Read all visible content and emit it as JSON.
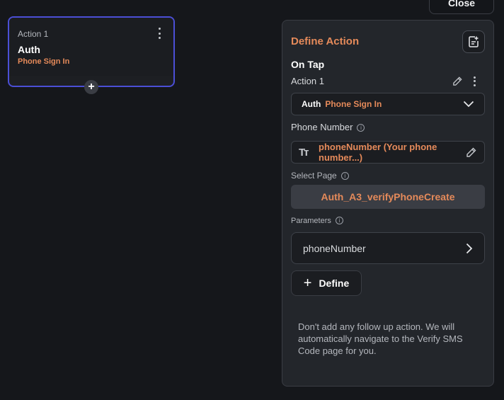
{
  "header": {
    "close_label": "Close"
  },
  "action_node": {
    "title": "Action 1",
    "name": "Auth",
    "subtitle": "Phone Sign In",
    "add_symbol": "+"
  },
  "panel": {
    "title": "Define Action",
    "trigger": "On Tap",
    "action_label": "Action 1",
    "dropdown": {
      "main": "Auth",
      "sub": "Phone Sign In"
    },
    "phone_number_label": "Phone Number",
    "phone_number_value": "phoneNumber (Your phone number...)",
    "select_page_label": "Select Page",
    "select_page_value": "Auth_A3_verifyPhoneCreate",
    "parameters_label": "Parameters",
    "parameter_name": "phoneNumber",
    "define_label": "Define",
    "note": "Don't add any follow up action. We will automatically navigate to the Verify SMS Code page for you."
  },
  "icons": {
    "tt": "Tт",
    "info": "i",
    "plus": "+"
  },
  "colors": {
    "accent": "#e58a5a",
    "selection": "#4b4fd6",
    "background": "#15171b",
    "panel": "#23262b"
  }
}
